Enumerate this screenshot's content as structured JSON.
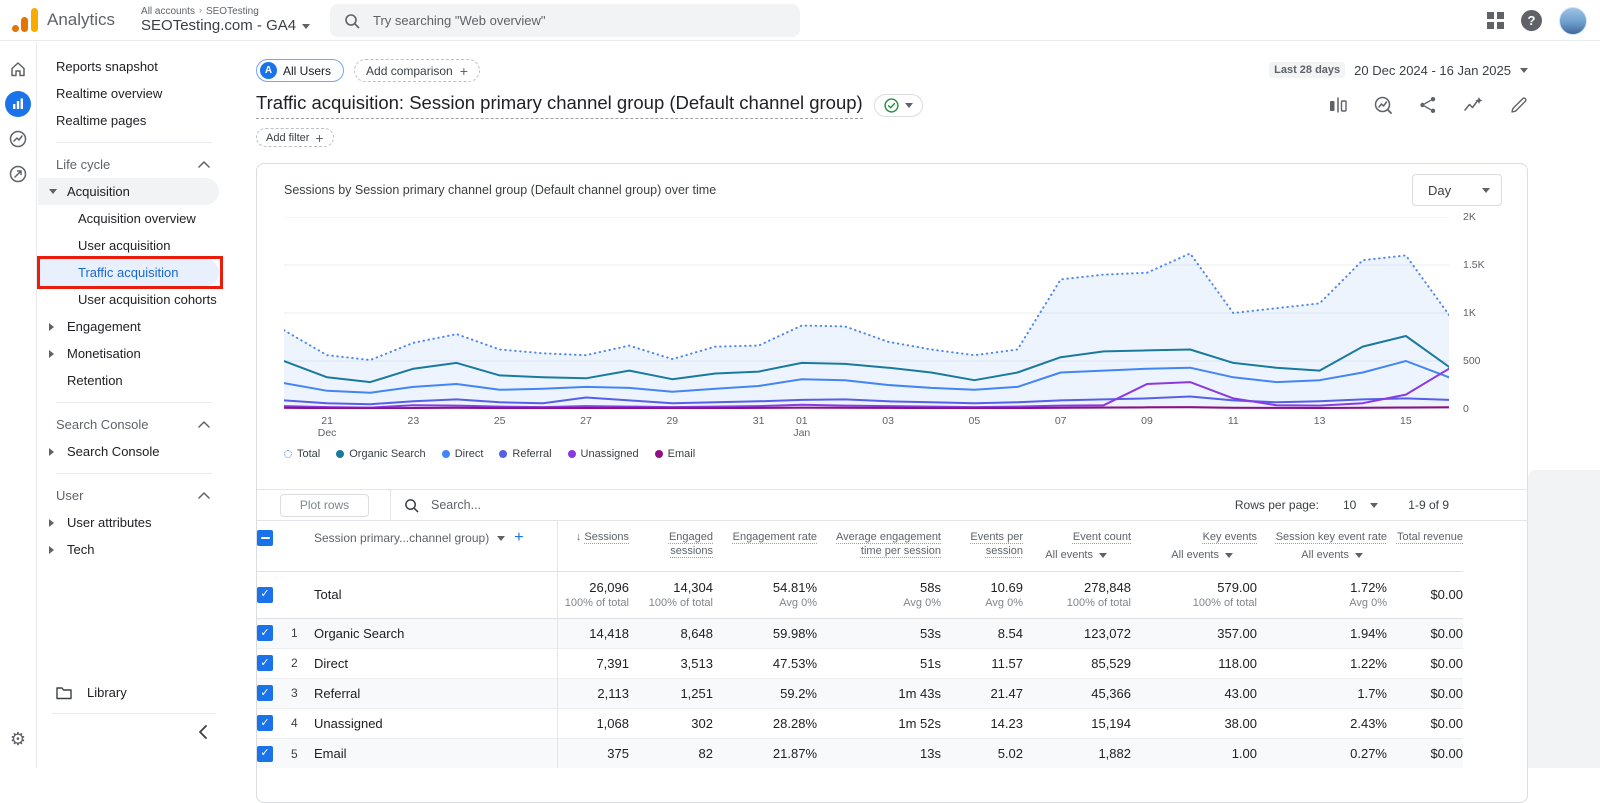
{
  "colors": {
    "accent": "#1a73e8",
    "annotation": "#ea1c0c",
    "active_bg": "#e8f0fe"
  },
  "header": {
    "brand": "Analytics",
    "breadcrumb_root": "All accounts",
    "breadcrumb_child": "SEOTesting",
    "property": "SEOTesting.com - GA4",
    "search_placeholder": "Try searching \"Web overview\"",
    "help_glyph": "?"
  },
  "sidebar": {
    "items": [
      {
        "t": "link",
        "label": "Reports snapshot"
      },
      {
        "t": "link",
        "label": "Realtime overview"
      },
      {
        "t": "link",
        "label": "Realtime pages"
      },
      {
        "t": "divider"
      },
      {
        "t": "section",
        "label": "Life cycle"
      },
      {
        "t": "parent",
        "label": "Acquisition",
        "expanded": true,
        "selected": true
      },
      {
        "t": "child",
        "label": "Acquisition overview"
      },
      {
        "t": "child",
        "label": "User acquisition"
      },
      {
        "t": "child",
        "label": "Traffic acquisition",
        "active": true,
        "annotated": true
      },
      {
        "t": "child",
        "label": "User acquisition cohorts"
      },
      {
        "t": "parent",
        "label": "Engagement"
      },
      {
        "t": "parent",
        "label": "Monetisation"
      },
      {
        "t": "link2",
        "label": "Retention"
      },
      {
        "t": "divider"
      },
      {
        "t": "section",
        "label": "Search Console"
      },
      {
        "t": "parent",
        "label": "Search Console"
      },
      {
        "t": "divider"
      },
      {
        "t": "section",
        "label": "User"
      },
      {
        "t": "parent",
        "label": "User attributes"
      },
      {
        "t": "parent",
        "label": "Tech"
      }
    ],
    "library_label": "Library",
    "annotation": {
      "type": "highlight-box",
      "target": "Traffic acquisition",
      "color": "#ea1c0c"
    }
  },
  "controls": {
    "audience_chip": "All Users",
    "audience_letter": "A",
    "add_comparison": "Add comparison",
    "add_filter": "Add filter",
    "date_preset": "Last 28 days",
    "date_range": "20 Dec 2024 - 16 Jan 2025"
  },
  "report": {
    "title": "Traffic acquisition: Session primary channel group (Default channel group)",
    "interval": "Day"
  },
  "chart_data": {
    "type": "line",
    "title": "Sessions by Session primary channel group (Default channel group) over time",
    "interval": "Day",
    "ylim": [
      0,
      2000
    ],
    "grid": true,
    "legend_position": "bottom",
    "x": [
      "20 Dec",
      "21 Dec",
      "22 Dec",
      "23 Dec",
      "24 Dec",
      "25 Dec",
      "26 Dec",
      "27 Dec",
      "28 Dec",
      "29 Dec",
      "30 Dec",
      "31 Dec",
      "01 Jan",
      "02 Jan",
      "03 Jan",
      "04 Jan",
      "05 Jan",
      "06 Jan",
      "07 Jan",
      "08 Jan",
      "09 Jan",
      "10 Jan",
      "11 Jan",
      "12 Jan",
      "13 Jan",
      "14 Jan",
      "15 Jan",
      "16 Jan"
    ],
    "x_ticks": [
      {
        "i": 1,
        "label": "21",
        "sub": "Dec"
      },
      {
        "i": 3,
        "label": "23"
      },
      {
        "i": 5,
        "label": "25"
      },
      {
        "i": 7,
        "label": "27"
      },
      {
        "i": 9,
        "label": "29"
      },
      {
        "i": 11,
        "label": "31"
      },
      {
        "i": 12,
        "label": "01",
        "sub": "Jan"
      },
      {
        "i": 14,
        "label": "03"
      },
      {
        "i": 16,
        "label": "05"
      },
      {
        "i": 18,
        "label": "07"
      },
      {
        "i": 20,
        "label": "09"
      },
      {
        "i": 22,
        "label": "11"
      },
      {
        "i": 24,
        "label": "13"
      },
      {
        "i": 26,
        "label": "15"
      }
    ],
    "y_ticks": [
      {
        "v": 2000,
        "label": "2K"
      },
      {
        "v": 1500,
        "label": "1.5K"
      },
      {
        "v": 1000,
        "label": "1K"
      },
      {
        "v": 500,
        "label": "500"
      },
      {
        "v": 0,
        "label": "0"
      }
    ],
    "series": [
      {
        "name": "Total",
        "color": "#4f87ee",
        "style": "dotted",
        "fill": "rgba(66,133,244,0.09)",
        "values": [
          820,
          560,
          510,
          690,
          780,
          620,
          580,
          560,
          660,
          520,
          650,
          660,
          870,
          860,
          700,
          620,
          560,
          620,
          1350,
          1400,
          1420,
          1620,
          1000,
          1050,
          1100,
          1550,
          1600,
          980
        ]
      },
      {
        "name": "Organic Search",
        "color": "#1a7a9d",
        "values": [
          500,
          330,
          280,
          420,
          480,
          350,
          330,
          320,
          400,
          310,
          370,
          390,
          480,
          470,
          430,
          380,
          300,
          380,
          540,
          600,
          610,
          620,
          480,
          430,
          400,
          650,
          760,
          440
        ]
      },
      {
        "name": "Direct",
        "color": "#4285f4",
        "values": [
          270,
          190,
          170,
          230,
          260,
          200,
          210,
          230,
          220,
          180,
          210,
          240,
          310,
          300,
          250,
          220,
          200,
          230,
          380,
          400,
          420,
          430,
          330,
          280,
          300,
          380,
          500,
          330
        ]
      },
      {
        "name": "Referral",
        "color": "#5560e8",
        "values": [
          90,
          60,
          50,
          80,
          100,
          70,
          60,
          120,
          90,
          60,
          70,
          80,
          95,
          100,
          80,
          70,
          60,
          70,
          90,
          100,
          110,
          130,
          90,
          70,
          80,
          100,
          110,
          95
        ]
      },
      {
        "name": "Unassigned",
        "color": "#8a3ae0",
        "values": [
          30,
          20,
          15,
          40,
          35,
          25,
          20,
          30,
          25,
          20,
          25,
          30,
          45,
          35,
          30,
          25,
          20,
          25,
          35,
          40,
          260,
          280,
          110,
          40,
          35,
          60,
          150,
          420
        ]
      },
      {
        "name": "Email",
        "color": "#8f0f87",
        "values": [
          12,
          8,
          6,
          10,
          14,
          9,
          7,
          10,
          9,
          7,
          9,
          11,
          15,
          14,
          11,
          9,
          7,
          9,
          14,
          16,
          18,
          20,
          14,
          11,
          10,
          14,
          16,
          18
        ]
      }
    ]
  },
  "table": {
    "toolbar": {
      "plot_rows": "Plot rows",
      "search_placeholder": "Search...",
      "rows_per_page_label": "Rows per page:",
      "rows_per_page": "10",
      "range": "1-9 of 9"
    },
    "dimension_header": "Session primary...channel group)",
    "columns": [
      {
        "label": "Sessions",
        "sorted": true
      },
      {
        "label": "Engaged sessions"
      },
      {
        "label": "Engagement rate"
      },
      {
        "label": "Average engagement time per session"
      },
      {
        "label": "Events per session"
      },
      {
        "label": "Event count",
        "filter": "All events"
      },
      {
        "label": "Key events",
        "filter": "All events"
      },
      {
        "label": "Session key event rate",
        "filter": "All events"
      },
      {
        "label": "Total revenue"
      }
    ],
    "total_row": {
      "label": "Total",
      "values": [
        "26,096",
        "14,304",
        "54.81%",
        "58s",
        "10.69",
        "278,848",
        "579.00",
        "1.72%",
        "$0.00"
      ],
      "subs": [
        "100% of total",
        "100% of total",
        "Avg 0%",
        "Avg 0%",
        "Avg 0%",
        "100% of total",
        "100% of total",
        "Avg 0%",
        ""
      ]
    },
    "rows": [
      {
        "index": "1",
        "channel": "Organic Search",
        "values": [
          "14,418",
          "8,648",
          "59.98%",
          "53s",
          "8.54",
          "123,072",
          "357.00",
          "1.94%",
          "$0.00"
        ]
      },
      {
        "index": "2",
        "channel": "Direct",
        "values": [
          "7,391",
          "3,513",
          "47.53%",
          "51s",
          "11.57",
          "85,529",
          "118.00",
          "1.22%",
          "$0.00"
        ]
      },
      {
        "index": "3",
        "channel": "Referral",
        "values": [
          "2,113",
          "1,251",
          "59.2%",
          "1m 43s",
          "21.47",
          "45,366",
          "43.00",
          "1.7%",
          "$0.00"
        ]
      },
      {
        "index": "4",
        "channel": "Unassigned",
        "values": [
          "1,068",
          "302",
          "28.28%",
          "1m 52s",
          "14.23",
          "15,194",
          "38.00",
          "2.43%",
          "$0.00"
        ]
      },
      {
        "index": "5",
        "channel": "Email",
        "values": [
          "375",
          "82",
          "21.87%",
          "13s",
          "5.02",
          "1,882",
          "1.00",
          "0.27%",
          "$0.00"
        ]
      }
    ]
  }
}
